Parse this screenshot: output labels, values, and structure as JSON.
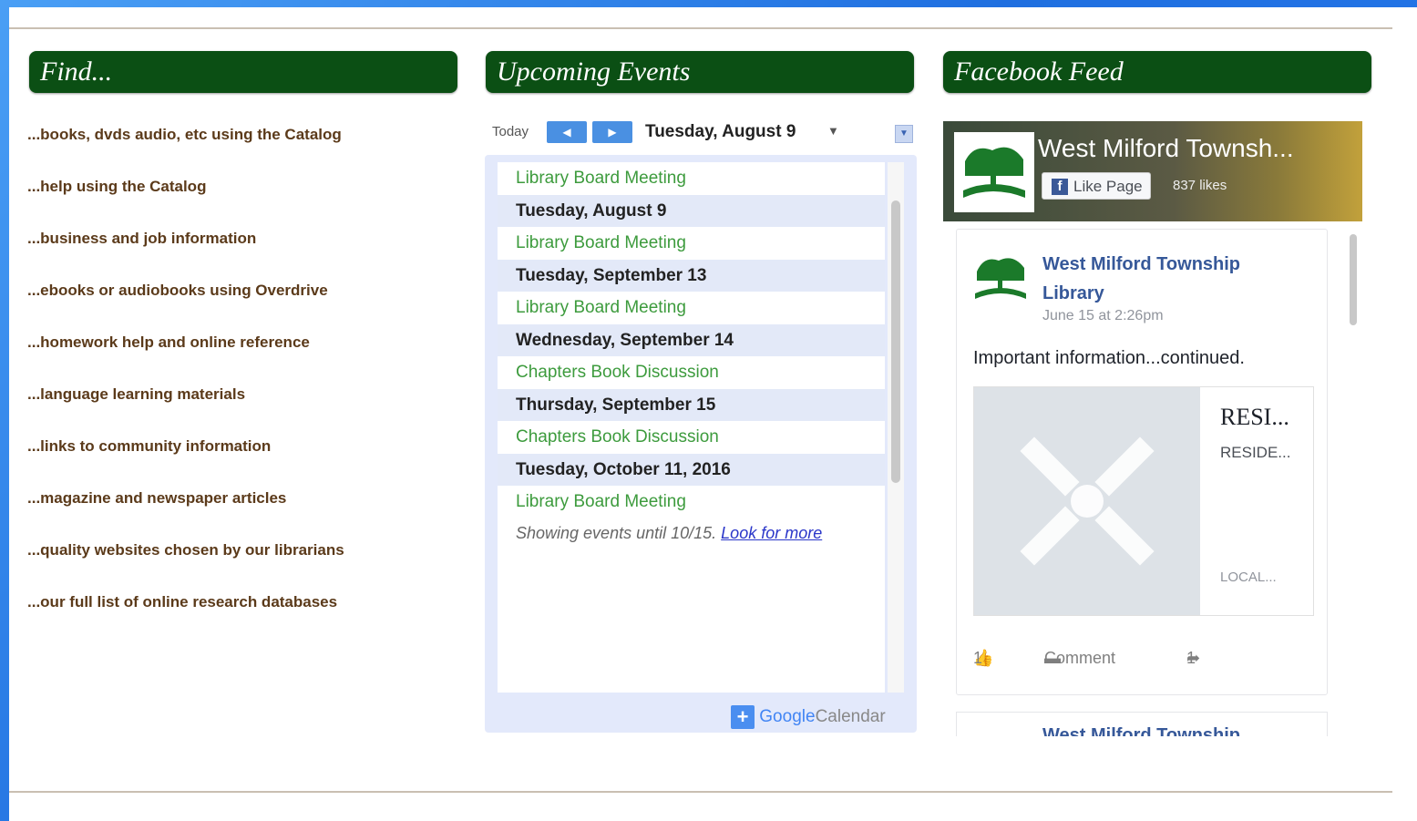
{
  "panels": {
    "find": {
      "title": "Find..."
    },
    "events": {
      "title": "Upcoming Events"
    },
    "facebook": {
      "title": "Facebook Feed"
    }
  },
  "find_links": [
    "...books, dvds audio, etc using the Catalog",
    "...help using the Catalog",
    "...business and job information",
    "...ebooks or audiobooks using Overdrive",
    "...homework help and online reference",
    "...language learning materials",
    "...links to community information",
    "...magazine and newspaper articles",
    "...quality websites chosen by our librarians",
    "...our full list of online research databases"
  ],
  "calendar": {
    "today_label": "Today",
    "prev_icon": "arrow-left-icon",
    "next_icon": "arrow-right-icon",
    "current_date": "Tuesday, August 9",
    "rows": [
      {
        "type": "event",
        "text": "Library Board Meeting"
      },
      {
        "type": "day",
        "text": "Tuesday, August 9"
      },
      {
        "type": "event",
        "text": "Library Board Meeting"
      },
      {
        "type": "day",
        "text": "Tuesday, September 13"
      },
      {
        "type": "event",
        "text": "Library Board Meeting"
      },
      {
        "type": "day",
        "text": "Wednesday, September 14"
      },
      {
        "type": "event",
        "text": "Chapters Book Discussion"
      },
      {
        "type": "day",
        "text": "Thursday, September 15"
      },
      {
        "type": "event",
        "text": "Chapters Book Discussion"
      },
      {
        "type": "day",
        "text": "Tuesday, October 11, 2016"
      },
      {
        "type": "event",
        "text": "Library Board Meeting"
      }
    ],
    "footer_text": "Showing events until 10/15.",
    "footer_link": "Look for more",
    "brand_word1": "Google",
    "brand_word2": "Calendar"
  },
  "facebook": {
    "page_name_short": "West Milford Townsh...",
    "like_button": "Like Page",
    "like_count": "837 likes",
    "post": {
      "author": "West Milford Township Library",
      "date": "June 15 at 2:26pm",
      "text": "Important information...continued.",
      "attachment_title": "RESI...",
      "attachment_sub": "RESIDE...",
      "attachment_domain": "LOCAL...",
      "likes": "1",
      "comment_label": "Comment",
      "shares": "1"
    },
    "post2_author": "West Milford Township"
  },
  "colors": {
    "header_green": "#0b4f14",
    "link_brown": "#5b3a1a",
    "event_green": "#3d9b3d",
    "fb_blue": "#365899"
  }
}
